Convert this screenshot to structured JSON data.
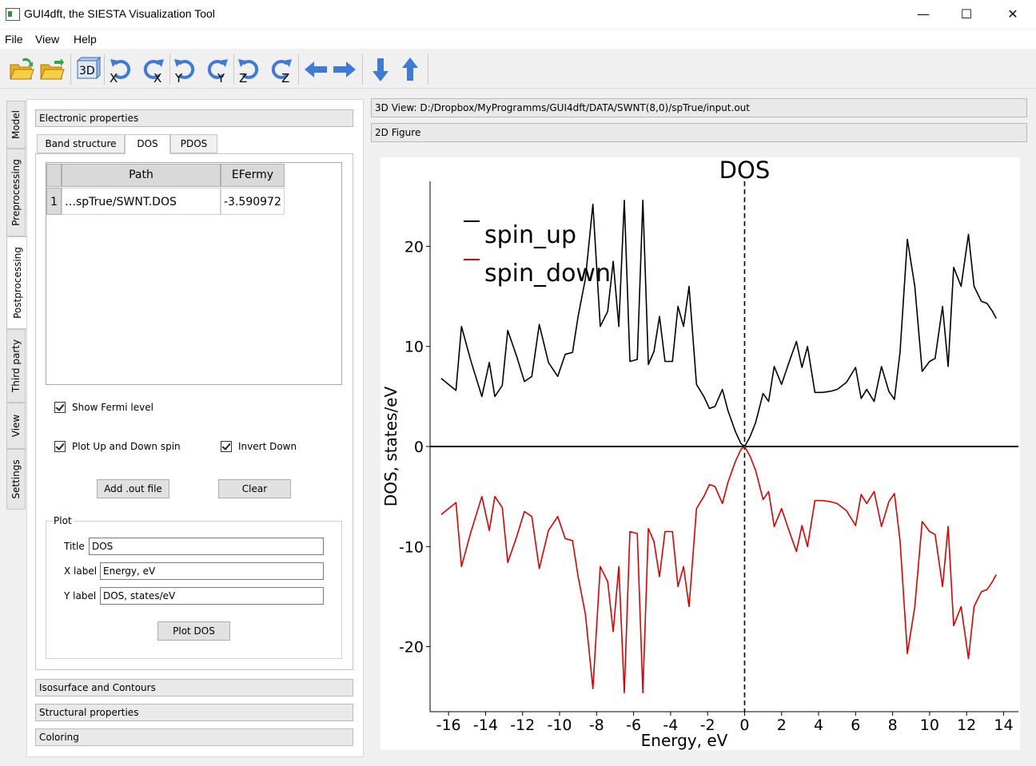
{
  "window": {
    "title": "GUI4dft, the SIESTA Visualization Tool",
    "minimize": "—",
    "maximize": "☐",
    "close": "✕"
  },
  "menu": [
    "File",
    "View",
    "Help"
  ],
  "toolbar": {
    "rotate_labels": [
      "X",
      "X",
      "Y",
      "Y",
      "Z",
      "Z"
    ],
    "view3d_label": "3D"
  },
  "side_tabs": [
    "Model",
    "Preprocessing",
    "Postprocessing",
    "Third party",
    "View",
    "Settings"
  ],
  "sections": {
    "electronic": "Electronic properties",
    "isosurface": "Isosurface and Contours",
    "structural": "Structural properties",
    "coloring": "Coloring"
  },
  "tabs": [
    "Band structure",
    "DOS",
    "PDOS"
  ],
  "table": {
    "headers": [
      "Path",
      "EFermy"
    ],
    "rows": [
      {
        "index": "1",
        "path": "…spTrue/SWNT.DOS",
        "efermy": "-3.590972"
      }
    ]
  },
  "options": {
    "show_fermi": "Show Fermi level",
    "plot_up_down": "Plot Up and Down spin",
    "invert_down": "Invert Down"
  },
  "buttons": {
    "add_out": "Add .out file",
    "clear": "Clear",
    "plot_dos": "Plot DOS"
  },
  "plot_group": {
    "label": "Plot",
    "title_label": "Title",
    "title_value": "DOS",
    "xlabel_label": "X label",
    "xlabel_value": "Energy, eV",
    "ylabel_label": "Y label",
    "ylabel_value": "DOS, states/eV"
  },
  "right_panel": {
    "view3d": "3D View: D:/Dropbox/MyProgramms/GUI4dft/DATA/SWNT(8,0)/spTrue/input.out",
    "figure2d": "2D Figure"
  },
  "chart_data": {
    "type": "line",
    "title": "DOS",
    "xlabel": "Energy, eV",
    "ylabel": "DOS, states/eV",
    "xlim": [
      -17.0,
      14.8
    ],
    "ylim": [
      -26.5,
      26.5
    ],
    "xticks": [
      -16,
      -14,
      -12,
      -10,
      -8,
      -6,
      -4,
      -2,
      0,
      2,
      4,
      6,
      8,
      10,
      12,
      14
    ],
    "yticks": [
      -20,
      -10,
      0,
      10,
      20
    ],
    "fermi_level": 0,
    "legend_position": "top-left",
    "series": [
      {
        "name": "spin_up",
        "color": "#000000",
        "x": [
          -16.4,
          -15.6,
          -15.3,
          -14.8,
          -14.2,
          -13.8,
          -13.5,
          -13.1,
          -12.8,
          -12.3,
          -11.9,
          -11.5,
          -11.1,
          -10.6,
          -10.1,
          -9.7,
          -9.3,
          -9.0,
          -8.6,
          -8.2,
          -7.8,
          -7.4,
          -7.1,
          -6.8,
          -6.5,
          -6.2,
          -5.8,
          -5.5,
          -5.2,
          -4.9,
          -4.6,
          -4.3,
          -3.9,
          -3.6,
          -3.3,
          -3.0,
          -2.6,
          -2.2,
          -1.9,
          -1.6,
          -1.2,
          -0.9,
          -0.5,
          -0.2,
          0.0,
          0.3,
          0.6,
          1.0,
          1.3,
          1.6,
          2.0,
          2.4,
          2.8,
          3.1,
          3.4,
          3.8,
          4.2,
          4.6,
          5.0,
          5.5,
          6.0,
          6.3,
          6.6,
          7.0,
          7.4,
          7.8,
          8.1,
          8.4,
          8.8,
          9.2,
          9.6,
          10.0,
          10.3,
          10.7,
          11.0,
          11.3,
          11.7,
          12.1,
          12.4,
          12.8,
          13.1,
          13.4,
          13.6
        ],
        "y": [
          6.8,
          5.6,
          12.0,
          8.6,
          5.0,
          8.4,
          5.0,
          6.1,
          11.6,
          8.9,
          6.5,
          7.0,
          12.2,
          8.4,
          7.0,
          9.2,
          9.4,
          13.0,
          16.8,
          24.2,
          12.0,
          13.5,
          18.5,
          12.0,
          24.6,
          8.5,
          8.7,
          24.6,
          8.2,
          9.5,
          13.0,
          8.5,
          8.5,
          14.0,
          12.0,
          16.0,
          6.2,
          5.0,
          3.8,
          4.0,
          5.7,
          3.6,
          1.5,
          0.3,
          0.0,
          1.0,
          2.4,
          5.3,
          4.5,
          8.0,
          6.2,
          8.4,
          10.5,
          7.9,
          10.0,
          5.4,
          5.4,
          5.5,
          5.7,
          6.4,
          7.9,
          4.8,
          5.7,
          4.5,
          8.0,
          5.5,
          4.7,
          9.4,
          20.7,
          16.0,
          7.5,
          8.5,
          8.8,
          14.0,
          8.0,
          17.9,
          16.0,
          21.2,
          16.0,
          14.5,
          14.3,
          13.5,
          12.8
        ]
      },
      {
        "name": "spin_down",
        "color": "#dd0000",
        "x": [
          -16.4,
          -15.6,
          -15.3,
          -14.8,
          -14.2,
          -13.8,
          -13.5,
          -13.1,
          -12.8,
          -12.3,
          -11.9,
          -11.5,
          -11.1,
          -10.6,
          -10.1,
          -9.7,
          -9.3,
          -9.0,
          -8.6,
          -8.2,
          -7.8,
          -7.4,
          -7.1,
          -6.8,
          -6.5,
          -6.2,
          -5.8,
          -5.5,
          -5.2,
          -4.9,
          -4.6,
          -4.3,
          -3.9,
          -3.6,
          -3.3,
          -3.0,
          -2.6,
          -2.2,
          -1.9,
          -1.6,
          -1.2,
          -0.9,
          -0.5,
          -0.2,
          0.0,
          0.3,
          0.6,
          1.0,
          1.3,
          1.6,
          2.0,
          2.4,
          2.8,
          3.1,
          3.4,
          3.8,
          4.2,
          4.6,
          5.0,
          5.5,
          6.0,
          6.3,
          6.6,
          7.0,
          7.4,
          7.8,
          8.1,
          8.4,
          8.8,
          9.2,
          9.6,
          10.0,
          10.3,
          10.7,
          11.0,
          11.3,
          11.7,
          12.1,
          12.4,
          12.8,
          13.1,
          13.4,
          13.6
        ],
        "y": [
          -6.8,
          -5.6,
          -12.0,
          -8.6,
          -5.0,
          -8.4,
          -5.0,
          -6.1,
          -11.6,
          -8.9,
          -6.5,
          -7.0,
          -12.2,
          -8.4,
          -7.0,
          -9.2,
          -9.4,
          -13.0,
          -16.8,
          -24.2,
          -12.0,
          -13.5,
          -18.5,
          -12.0,
          -24.6,
          -8.5,
          -8.7,
          -24.6,
          -8.2,
          -9.5,
          -13.0,
          -8.5,
          -8.5,
          -14.0,
          -12.0,
          -16.0,
          -6.2,
          -5.0,
          -3.8,
          -4.0,
          -5.7,
          -3.6,
          -1.5,
          -0.3,
          0.0,
          -1.0,
          -2.4,
          -5.3,
          -4.5,
          -8.0,
          -6.2,
          -8.4,
          -10.5,
          -7.9,
          -10.0,
          -5.4,
          -5.4,
          -5.5,
          -5.7,
          -6.4,
          -7.9,
          -4.8,
          -5.7,
          -4.5,
          -8.0,
          -5.5,
          -4.7,
          -9.4,
          -20.7,
          -16.0,
          -7.5,
          -8.5,
          -8.8,
          -14.0,
          -8.0,
          -17.9,
          -16.0,
          -21.2,
          -16.0,
          -14.5,
          -14.3,
          -13.5,
          -12.8
        ]
      }
    ]
  }
}
